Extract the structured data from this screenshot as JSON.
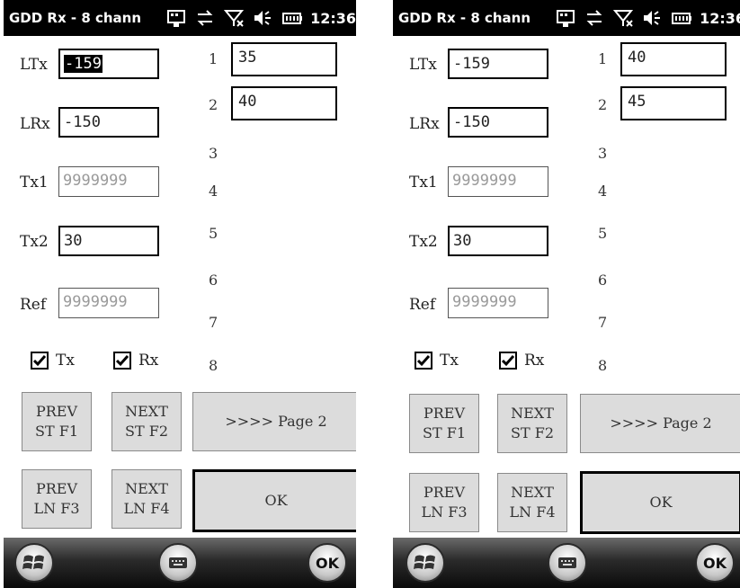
{
  "screens": [
    {
      "status": {
        "title": "GDD Rx - 8 chann",
        "time": "12:36"
      },
      "fields": {
        "ltx": {
          "label": "LTx",
          "value": "-159"
        },
        "lrx": {
          "label": "LRx",
          "value": "-150"
        },
        "tx1": {
          "label": "Tx1",
          "value": "9999999"
        },
        "tx2": {
          "label": "Tx2",
          "value": "30"
        },
        "ref": {
          "label": "Ref",
          "value": "9999999"
        }
      },
      "channels": [
        {
          "num": "1",
          "value": "35"
        },
        {
          "num": "2",
          "value": "40"
        },
        {
          "num": "3",
          "value": ""
        },
        {
          "num": "4",
          "value": ""
        },
        {
          "num": "5",
          "value": ""
        },
        {
          "num": "6",
          "value": ""
        },
        {
          "num": "7",
          "value": ""
        },
        {
          "num": "8",
          "value": ""
        }
      ],
      "checkboxes": {
        "tx": "Tx",
        "rx": "Rx"
      },
      "buttons": {
        "prev_st": [
          "PREV",
          "ST F1"
        ],
        "next_st": [
          "NEXT",
          "ST F2"
        ],
        "page2": ">>>> Page 2",
        "prev_ln": [
          "PREV",
          "LN F3"
        ],
        "next_ln": [
          "NEXT",
          "LN F4"
        ],
        "ok": "OK"
      },
      "menubar": {
        "ok": "OK"
      }
    },
    {
      "status": {
        "title": "GDD Rx - 8 chann",
        "time": "12:36"
      },
      "fields": {
        "ltx": {
          "label": "LTx",
          "value": "-159"
        },
        "lrx": {
          "label": "LRx",
          "value": "-150"
        },
        "tx1": {
          "label": "Tx1",
          "value": "9999999"
        },
        "tx2": {
          "label": "Tx2",
          "value": "30"
        },
        "ref": {
          "label": "Ref",
          "value": "9999999"
        }
      },
      "channels": [
        {
          "num": "1",
          "value": "40"
        },
        {
          "num": "2",
          "value": "45"
        },
        {
          "num": "3",
          "value": ""
        },
        {
          "num": "4",
          "value": ""
        },
        {
          "num": "5",
          "value": ""
        },
        {
          "num": "6",
          "value": ""
        },
        {
          "num": "7",
          "value": ""
        },
        {
          "num": "8",
          "value": ""
        }
      ],
      "checkboxes": {
        "tx": "Tx",
        "rx": "Rx"
      },
      "buttons": {
        "prev_st": [
          "PREV",
          "ST F1"
        ],
        "next_st": [
          "NEXT",
          "ST F2"
        ],
        "page2": ">>>> Page 2",
        "prev_ln": [
          "PREV",
          "LN F3"
        ],
        "next_ln": [
          "NEXT",
          "LN F4"
        ],
        "ok": "OK"
      },
      "menubar": {
        "ok": "OK"
      }
    }
  ]
}
